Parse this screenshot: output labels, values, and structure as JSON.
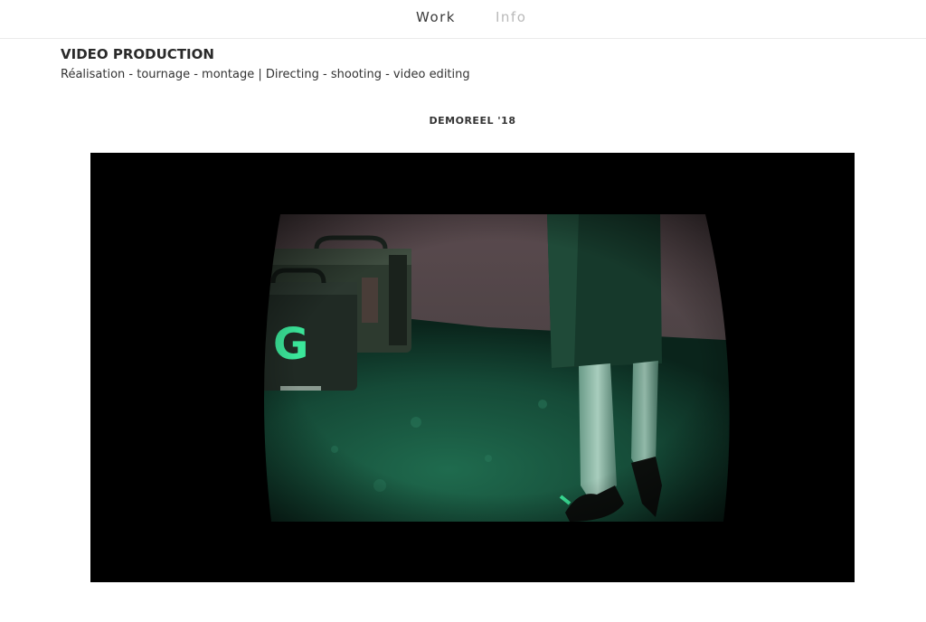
{
  "nav": {
    "work_label": "Work",
    "info_label": "Info",
    "colors": {
      "active": "#3a3a3a",
      "inactive": "#b9b9b9"
    }
  },
  "section": {
    "title": "VIDEO PRODUCTION",
    "subtitle": "Réalisation - tournage - montage | Directing - shooting - video editing"
  },
  "video": {
    "heading": "DEMOREEL '18",
    "frame_letter": "G"
  }
}
